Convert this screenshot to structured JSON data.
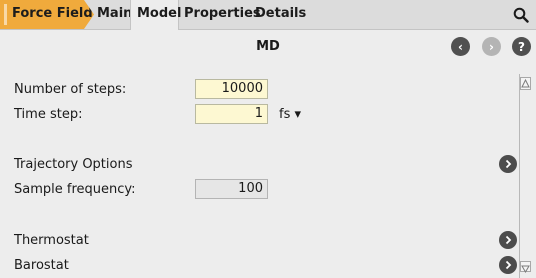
{
  "tabs": [
    {
      "label": "Force Field",
      "active": true
    },
    {
      "label": "Main"
    },
    {
      "label": "Model",
      "selected": true
    },
    {
      "label": "Properties"
    },
    {
      "label": "Details"
    }
  ],
  "toolbar": {
    "search_icon": "search-icon"
  },
  "header": {
    "title": "MD",
    "back_icon": "‹",
    "forward_icon": "›",
    "help_icon": "?"
  },
  "form": {
    "steps_label": "Number of steps:",
    "steps_value": "10000",
    "timestep_label": "Time step:",
    "timestep_value": "1",
    "timestep_unit": "fs ▾",
    "trajectory_label": "Trajectory Options",
    "sample_label": "Sample frequency:",
    "sample_value": "100",
    "thermostat_label": "Thermostat",
    "barostat_label": "Barostat"
  },
  "colors": {
    "accent": "#f0aa3c",
    "field_bg": "#fdf8d2",
    "panel_bg": "#ededed"
  }
}
